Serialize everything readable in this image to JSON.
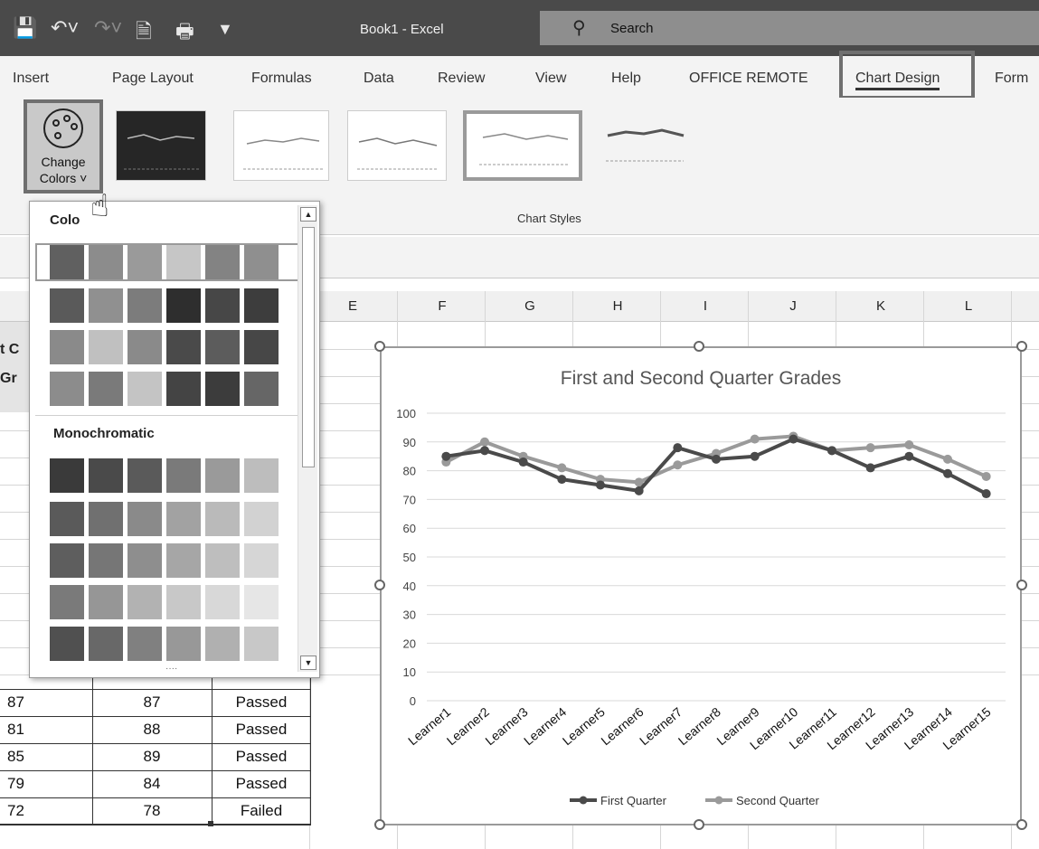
{
  "window": {
    "title": "Book1 - Excel"
  },
  "search": {
    "label": "Search"
  },
  "tabs": [
    "Insert",
    "Page Layout",
    "Formulas",
    "Data",
    "Review",
    "View",
    "Help",
    "OFFICE REMOTE",
    "Chart Design",
    "Form"
  ],
  "active_tab": "Chart Design",
  "ribbon": {
    "change_colors_line1": "Change",
    "change_colors_line2": "Colors ˅",
    "group_label": "Chart Styles"
  },
  "dropdown": {
    "colorful_label": "Colo",
    "mono_label": "Monochromatic",
    "colorful_rows": [
      [
        "#606060",
        "#8c8c8c",
        "#9a9a9a",
        "#c6c6c6",
        "#838383",
        "#8f8f8f"
      ],
      [
        "#5a5a5a",
        "#909090",
        "#7c7c7c",
        "#2e2e2e",
        "#474747",
        "#3d3d3d"
      ],
      [
        "#8a8a8a",
        "#c0c0c0",
        "#8a8a8a",
        "#4a4a4a",
        "#5c5c5c",
        "#474747"
      ],
      [
        "#8c8c8c",
        "#7a7a7a",
        "#c4c4c4",
        "#444444",
        "#3c3c3c",
        "#666666"
      ]
    ],
    "mono_rows": [
      [
        "#3a3a3a",
        "#4a4a4a",
        "#5a5a5a",
        "#7a7a7a",
        "#9a9a9a",
        "#bdbdbd"
      ],
      [
        "#5a5a5a",
        "#707070",
        "#8a8a8a",
        "#a2a2a2",
        "#bababa",
        "#d2d2d2"
      ],
      [
        "#5e5e5e",
        "#767676",
        "#8e8e8e",
        "#a6a6a6",
        "#bebebe",
        "#d6d6d6"
      ],
      [
        "#7a7a7a",
        "#969696",
        "#b2b2b2",
        "#c8c8c8",
        "#d8d8d8",
        "#e6e6e6"
      ],
      [
        "#505050",
        "#686868",
        "#808080",
        "#989898",
        "#b0b0b0",
        "#c8c8c8"
      ]
    ]
  },
  "sheet": {
    "columns": [
      "E",
      "F",
      "G",
      "H",
      "I",
      "J",
      "K",
      "L"
    ],
    "left_header_cut": [
      "t C",
      "Gr"
    ],
    "rows": [
      {
        "a": "87",
        "b": "87",
        "c": "Passed"
      },
      {
        "a": "81",
        "b": "88",
        "c": "Passed"
      },
      {
        "a": "85",
        "b": "89",
        "c": "Passed"
      },
      {
        "a": "79",
        "b": "84",
        "c": "Passed"
      },
      {
        "a": "72",
        "b": "78",
        "c": "Failed"
      }
    ]
  },
  "colors": {
    "first_quarter": "#4a4a4a",
    "second_quarter": "#9a9a9a",
    "ribbon_bg": "#f3f3f3",
    "titlebar_bg": "#4a4a4a"
  },
  "chart_data": {
    "type": "line",
    "title": "First and Second Quarter Grades",
    "categories": [
      "Learner1",
      "Learner2",
      "Learner3",
      "Learner4",
      "Learner5",
      "Learner6",
      "Learner7",
      "Learner8",
      "Learner9",
      "Learner10",
      "Learner11",
      "Learner12",
      "Learner13",
      "Learner14",
      "Learner15"
    ],
    "series": [
      {
        "name": "First Quarter",
        "values": [
          85,
          87,
          83,
          77,
          75,
          73,
          88,
          84,
          85,
          91,
          87,
          81,
          85,
          79,
          72
        ]
      },
      {
        "name": "Second Quarter",
        "values": [
          83,
          90,
          85,
          81,
          77,
          76,
          82,
          86,
          91,
          92,
          87,
          88,
          89,
          84,
          78
        ]
      }
    ],
    "ylim": [
      0,
      100
    ],
    "yticks": [
      0,
      10,
      20,
      30,
      40,
      50,
      60,
      70,
      80,
      90,
      100
    ],
    "legend": "bottom",
    "grid": true
  }
}
